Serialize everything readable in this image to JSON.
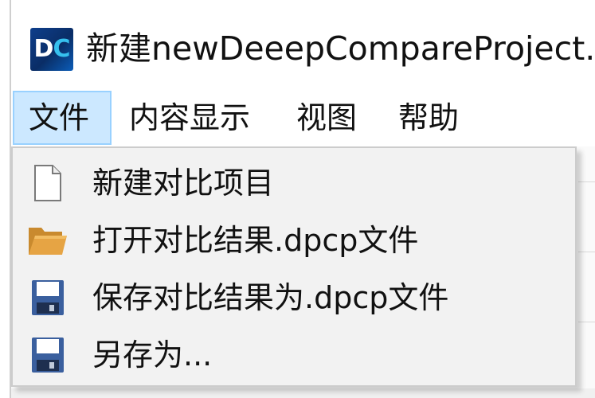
{
  "window": {
    "title": "新建newDeeepCompareProject.",
    "logo_text_d": "D",
    "logo_text_c": "C",
    "logo_icon": "deepcompare-logo-icon"
  },
  "menubar": {
    "items": [
      {
        "label": "文件",
        "active": true
      },
      {
        "label": "内容显示",
        "active": false
      },
      {
        "label": "视图",
        "active": false
      },
      {
        "label": "帮助",
        "active": false
      }
    ]
  },
  "file_menu": {
    "items": [
      {
        "label": "新建对比项目",
        "icon": "new-file-icon"
      },
      {
        "label": "打开对比结果.dpcp文件",
        "icon": "open-folder-icon"
      },
      {
        "label": "保存对比结果为.dpcp文件",
        "icon": "save-disk-icon"
      },
      {
        "label": "另存为...",
        "icon": "save-as-disk-icon"
      }
    ]
  },
  "colors": {
    "menu_active_bg": "#cce8ff",
    "menu_active_border": "#99d1ff",
    "dropdown_bg": "#f2f2f2",
    "logo_bg": "#0e3f8c",
    "logo_accent": "#36c0ee"
  }
}
